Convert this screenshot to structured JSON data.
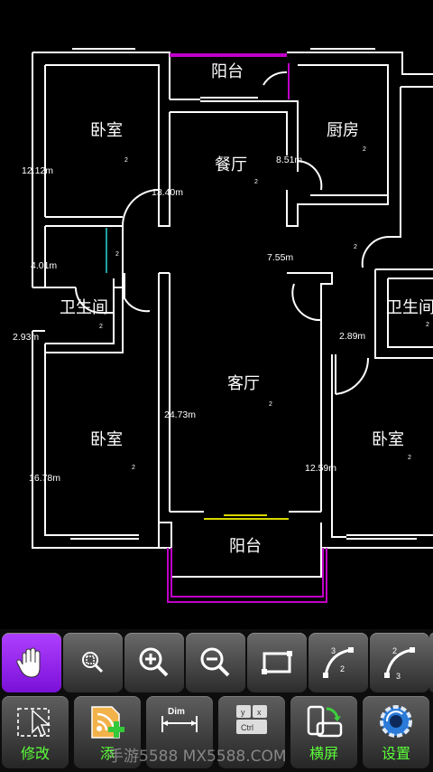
{
  "plan": {
    "rooms": {
      "bedroom_tl": "卧室",
      "balcony_top": "阳台",
      "kitchen": "厨房",
      "dining": "餐厅",
      "bath_left": "卫生间",
      "bath_right": "卫生间",
      "living": "客厅",
      "bedroom_bl": "卧室",
      "bedroom_br": "卧室",
      "balcony_bottom": "阳台"
    },
    "measurements": {
      "bedroom_tl": "12.12m",
      "passage": "13.40m",
      "kitchen": "8.51m",
      "hall_left": "4.01m",
      "hall_right": "7.55m",
      "bath_left": "2.93m",
      "bath_right": "2.89m",
      "living": "24.73m",
      "bedroom_bl": "16.78m",
      "bedroom_br": "12.59m"
    },
    "marker": "2"
  },
  "toolbar": {
    "row1": [
      {
        "icon": "hand-pan-icon",
        "active": true
      },
      {
        "icon": "zoom-fit-icon"
      },
      {
        "icon": "zoom-in-icon"
      },
      {
        "icon": "zoom-out-icon"
      },
      {
        "icon": "rectangle-window-icon"
      },
      {
        "icon": "arc-3point-icon",
        "glyph": "3 2"
      },
      {
        "icon": "arc-2point-icon",
        "glyph": "2 3"
      }
    ],
    "row2": [
      {
        "icon": "select-cursor-icon",
        "label": "修改"
      },
      {
        "icon": "add-layer-icon",
        "label": "添"
      },
      {
        "icon": "dimension-icon",
        "label": "",
        "glyph": "Dim"
      },
      {
        "icon": "keyboard-ctrl-icon",
        "label": "",
        "glyph": "Ctrl"
      },
      {
        "icon": "rotate-screen-icon",
        "label": "横屏"
      },
      {
        "icon": "settings-gear-icon",
        "label": "设置"
      }
    ]
  },
  "watermark": "手游5588 MX5588.COM"
}
